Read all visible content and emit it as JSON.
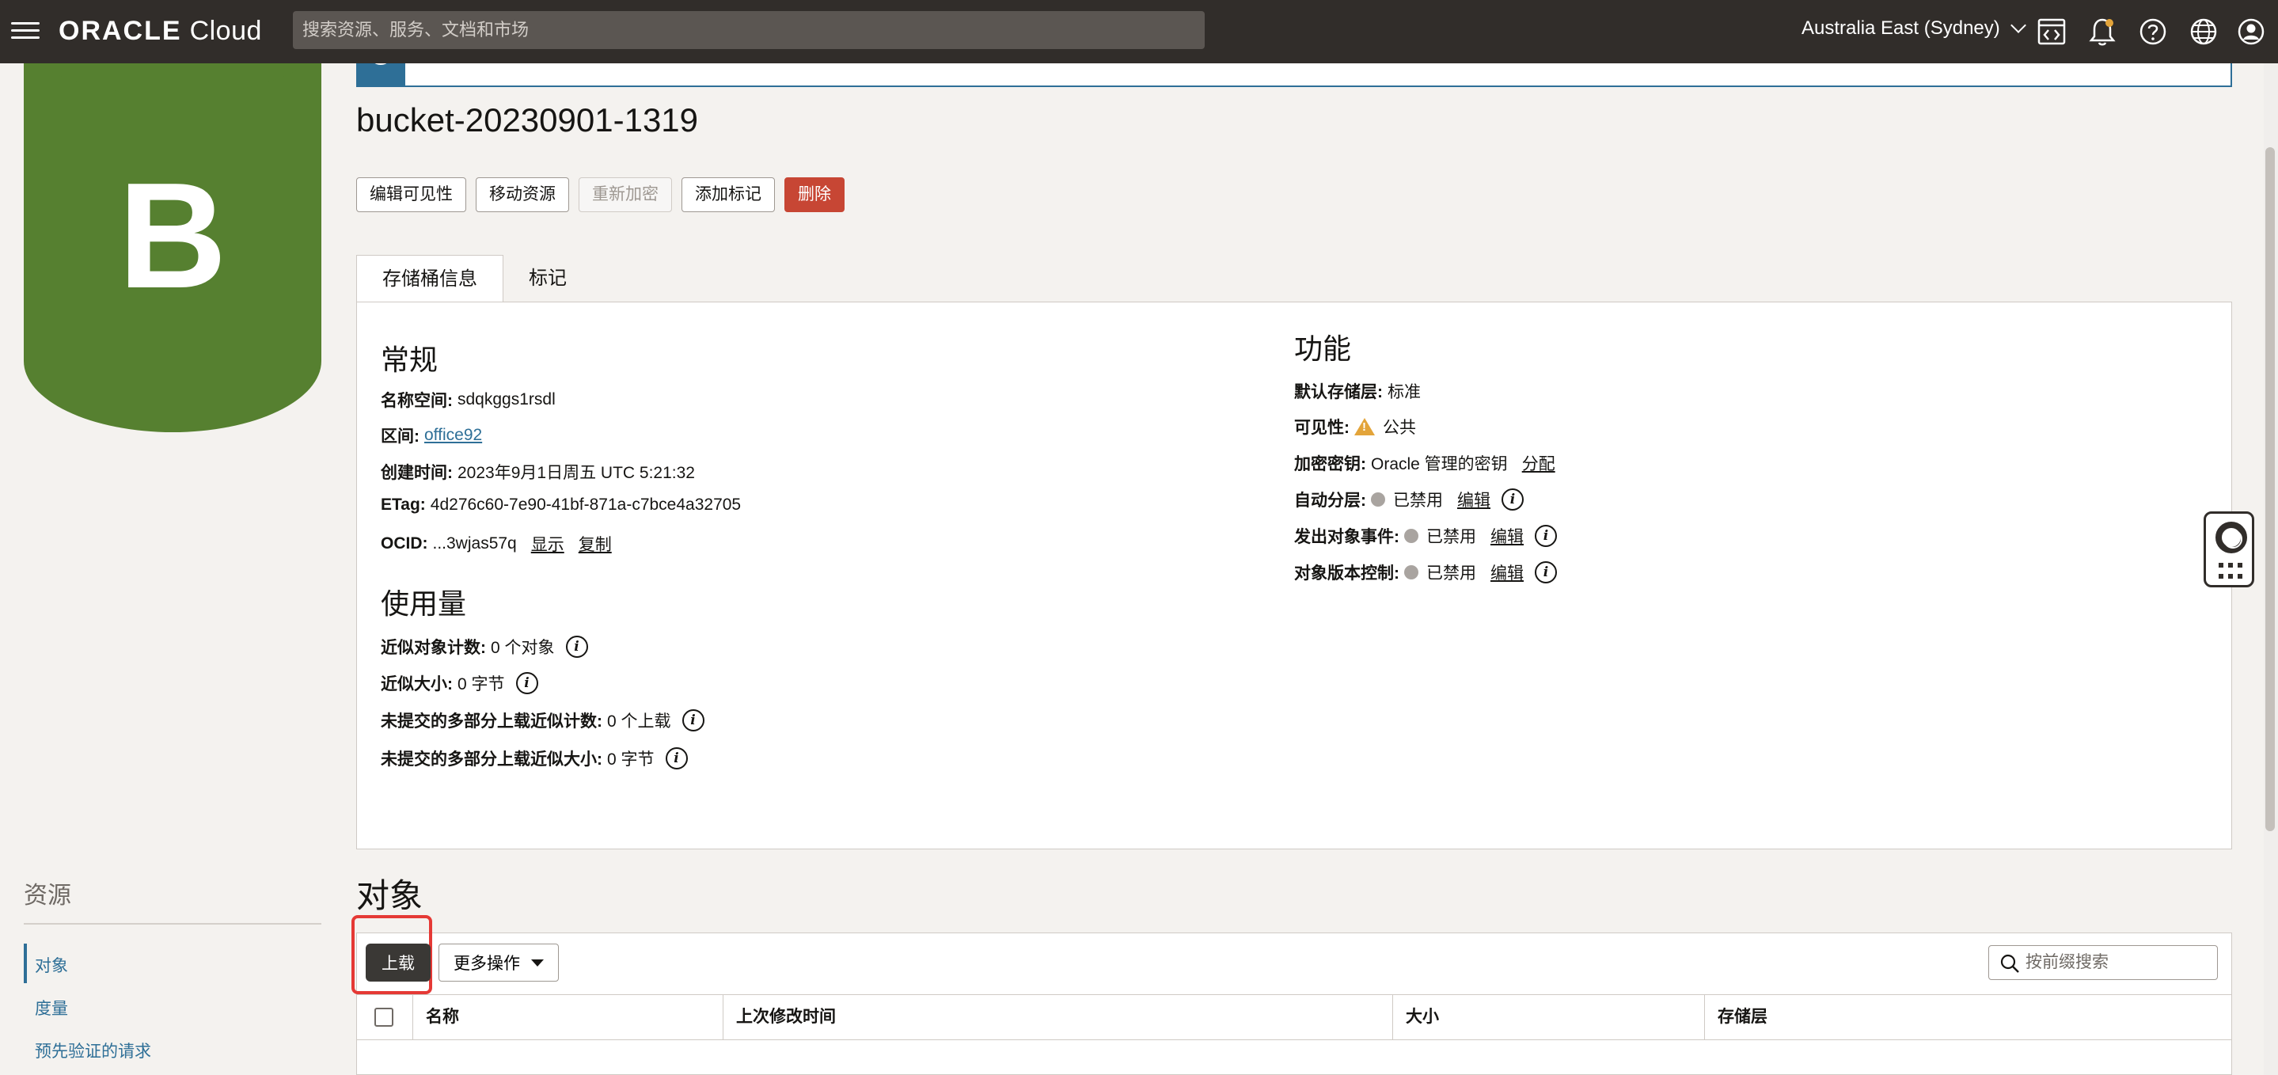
{
  "topbar": {
    "logo_oracle": "ORACLE",
    "logo_cloud": "Cloud",
    "search_placeholder": "搜索资源、服务、文档和市场",
    "region": "Australia East (Sydney)"
  },
  "avatar": {
    "letter": "B",
    "color": "#568030"
  },
  "bucket": {
    "title": "bucket-20230901-1319",
    "actions": [
      {
        "label": "编辑可见性",
        "state": "enabled"
      },
      {
        "label": "移动资源",
        "state": "enabled"
      },
      {
        "label": "重新加密",
        "state": "disabled"
      },
      {
        "label": "添加标记",
        "state": "enabled"
      },
      {
        "label": "删除",
        "state": "danger"
      }
    ]
  },
  "tabs": [
    {
      "label": "存储桶信息",
      "active": true
    },
    {
      "label": "标记",
      "active": false
    }
  ],
  "general": {
    "heading": "常规",
    "namespace_label": "名称空间:",
    "namespace_value": "sdqkggs1rsdl",
    "compartment_label": "区间:",
    "compartment_value": "office92",
    "created_label": "创建时间:",
    "created_value": "2023年9月1日周五 UTC 5:21:32",
    "etag_label": "ETag:",
    "etag_value": "4d276c60-7e90-41bf-871a-c7bce4a32705",
    "ocid_label": "OCID:",
    "ocid_value": "...3wjas57q",
    "ocid_show": "显示",
    "ocid_copy": "复制"
  },
  "usage": {
    "heading": "使用量",
    "items": [
      {
        "label": "近似对象计数:",
        "value": "0 个对象"
      },
      {
        "label": "近似大小:",
        "value": "0 字节"
      },
      {
        "label": "未提交的多部分上载近似计数:",
        "value": "0 个上载"
      },
      {
        "label": "未提交的多部分上载近似大小:",
        "value": "0 字节"
      }
    ]
  },
  "features": {
    "heading": "功能",
    "storage_tier_label": "默认存储层:",
    "storage_tier_value": "标准",
    "visibility_label": "可见性:",
    "visibility_value": "公共",
    "encryption_label": "加密密钥:",
    "encryption_value": "Oracle 管理的密钥",
    "encryption_action": "分配",
    "auto_tier_label": "自动分层:",
    "auto_tier_value": "已禁用",
    "events_label": "发出对象事件:",
    "events_value": "已禁用",
    "versioning_label": "对象版本控制:",
    "versioning_value": "已禁用",
    "edit_label": "编辑"
  },
  "resources": {
    "heading": "资源",
    "items": [
      {
        "label": "对象",
        "active": true
      },
      {
        "label": "度量",
        "active": false
      },
      {
        "label": "预先验证的请求",
        "active": false
      }
    ]
  },
  "objects": {
    "heading": "对象",
    "upload_label": "上载",
    "more_actions_label": "更多操作",
    "search_placeholder": "按前缀搜索",
    "columns": [
      "名称",
      "上次修改时间",
      "大小",
      "存储层"
    ]
  },
  "colors": {
    "topbar": "#312d2a",
    "accent": "#2e6f97",
    "danger": "#c74634",
    "highlight": "#e53935"
  }
}
